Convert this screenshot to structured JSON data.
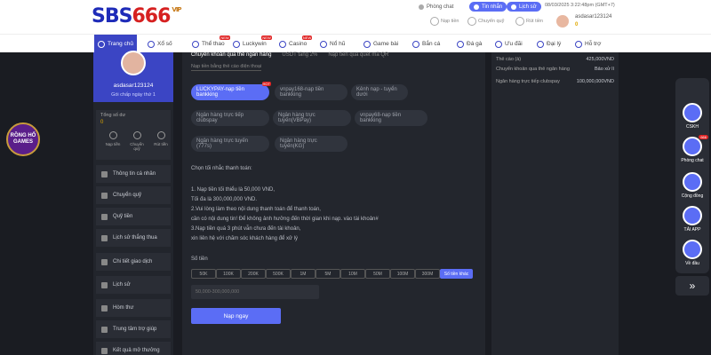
{
  "brand": {
    "logo_main": "SBS",
    "logo_accent": "666",
    "logo_tag": "VIP"
  },
  "header": {
    "chat": "Phòng chat",
    "inbox": "Tin nhắn",
    "history": "Lịch sử",
    "datetime": "08/03/2025 3:22:48pm",
    "timezone": "(GMT+7)",
    "deposit": "Nạp tiền",
    "transfer": "Chuyển quỹ",
    "withdraw": "Rút tiền",
    "username": "asdasar123124",
    "balance": "0"
  },
  "nav": {
    "items": [
      {
        "label": "Trang chủ",
        "new": ""
      },
      {
        "label": "Xổ số",
        "new": ""
      },
      {
        "label": "Thể thao",
        "new": "NEW"
      },
      {
        "label": "Luckywin",
        "new": "NEW"
      },
      {
        "label": "Casino",
        "new": "NEW"
      },
      {
        "label": "Nổ hũ",
        "new": ""
      },
      {
        "label": "Game bài",
        "new": ""
      },
      {
        "label": "Bắn cá",
        "new": ""
      },
      {
        "label": "Đá gà",
        "new": ""
      },
      {
        "label": "Ưu đãi",
        "new": ""
      },
      {
        "label": "Đại lý",
        "new": ""
      },
      {
        "label": "Hỗ trợ",
        "new": ""
      }
    ]
  },
  "sidebar": {
    "username": "asdasar123124",
    "vip": "Gói chấp ngày thứ 1",
    "balance_title": "Tổng số dư",
    "balance_value": "0",
    "actions": [
      "Nạp tiền",
      "Chuyển quỹ",
      "Rút tiền"
    ],
    "menu": [
      "Thông tin cá nhân",
      "Chuyển quỹ",
      "Quỹ tiền",
      "Lịch sử thắng thua",
      "Chi tiết giao dịch",
      "Lịch sử",
      "Hòm thư",
      "Trung tâm trợ giúp",
      "Kết quả mở thưởng"
    ]
  },
  "main": {
    "tabs": [
      "Chuyển khoản qua thẻ ngân hàng",
      "USDT tăng 2%",
      "Nạp tiền qua quét mã QR"
    ],
    "subtab": "Nạp tiền bằng thẻ cào điện thoại",
    "methods": [
      "LUCKYPAY-nạp tiền bankking",
      "vnpay168-nạp tiền bankking",
      "Kênh nạp - tuyển dưới",
      "Ngân hàng trực tiếp clubspay",
      "Ngân hàng trực tuyến(VBPay)",
      "vnpay68-nạp tiền bankking",
      "Ngân hàng trực tuyến (777s)",
      "Ngân hàng trực tuyến(KG)"
    ],
    "hot_tag": "HOT",
    "choose_note": "Chọn tối nhắc thanh toán:",
    "notes": [
      "1. Nạp tiền tối thiểu là 50,000 VND,",
      "Tối đa là 300,000,000 VND.",
      "2.Vui lòng làm theo nội dung thanh toán để thanh toán,",
      "cần có nội dung tin! Để không ảnh hưởng đến thời gian khi nạp. vào tài khoản#",
      "3.Nạp tiền quá 3 phút vẫn chưa đến tài khoản,",
      "xin liên hệ với chăm sóc khách hàng để xử lý"
    ],
    "amount_label": "Số tiền",
    "amounts": [
      "50K",
      "100K",
      "200K",
      "500K",
      "1M",
      "5M",
      "10M",
      "50M",
      "100M",
      "300M"
    ],
    "other_amount": "Số tiền khác",
    "amount_placeholder": "50,000-300,000,000",
    "submit": "Nạp ngay"
  },
  "right": {
    "rows": [
      {
        "k": "Thẻ cào (à)",
        "v": "425,000VND"
      },
      {
        "k": "Chuyển khoản qua thẻ ngân hàng",
        "v": "Bảo xử lí"
      },
      {
        "k": "Ngân hàng trực tiếp clubspay",
        "v": "100,000,000VND"
      }
    ]
  },
  "floating": {
    "items": [
      "CSKH",
      "Phòng chat",
      "Cộng đồng",
      "TẢI APP",
      "Về đầu"
    ],
    "chat_badge": "666"
  },
  "game_badge": "RỒNG HỔ GAMES",
  "colors": {
    "accent": "#5b6df5",
    "nav_active": "#3b45c4",
    "hot": "#e02424"
  }
}
